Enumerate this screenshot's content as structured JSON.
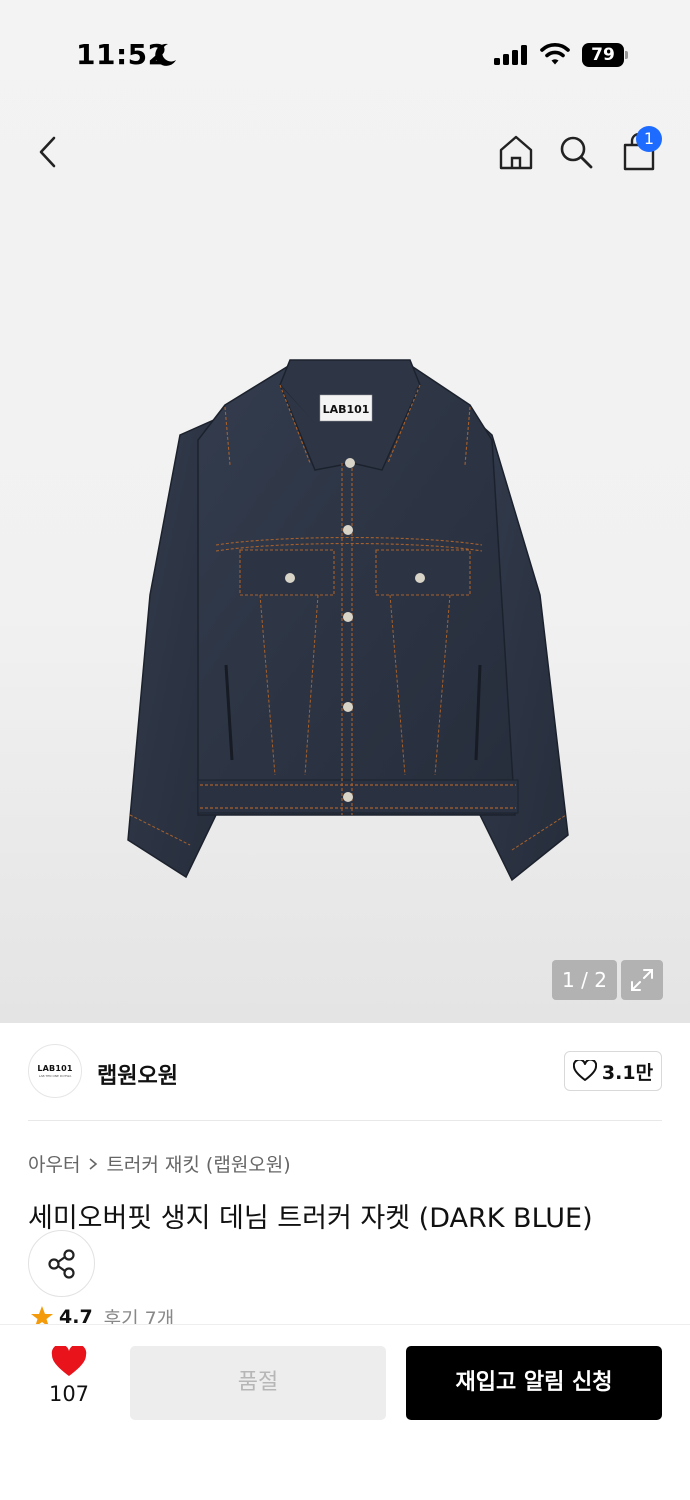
{
  "status_bar": {
    "time": "11:52",
    "battery": "79"
  },
  "header": {
    "cart_count": "1"
  },
  "gallery": {
    "pager": "1 / 2",
    "garment_label": "LAB101"
  },
  "brand": {
    "logo_text": "LAB101",
    "logo_subtext": "LAB TEN ONE DOTWA",
    "name": "랩원오원",
    "likes": "3.1만"
  },
  "breadcrumb": {
    "category": "아우터",
    "subcategory": "트러커 재킷 (랩원오원)"
  },
  "product": {
    "title": "세미오버핏 생지 데님 트러커 자켓 (DARK BLUE)",
    "rating": "4.7",
    "reviews": "후기 7개"
  },
  "bottom_bar": {
    "heart_count": "107",
    "soldout_label": "품절",
    "restock_label": "재입고 알림 신청"
  },
  "colors": {
    "accent_blue": "#1e6bff",
    "heart_red": "#e8131b",
    "star_orange": "#f49b0b",
    "denim": "#2c3444"
  },
  "icons": [
    "moon-icon",
    "signal-icon",
    "wifi-icon",
    "back-arrow-icon",
    "home-icon",
    "search-icon",
    "shopping-bag-icon",
    "expand-icon",
    "heart-outline-icon",
    "chevron-right-icon",
    "share-icon",
    "star-icon",
    "heart-filled-icon"
  ]
}
